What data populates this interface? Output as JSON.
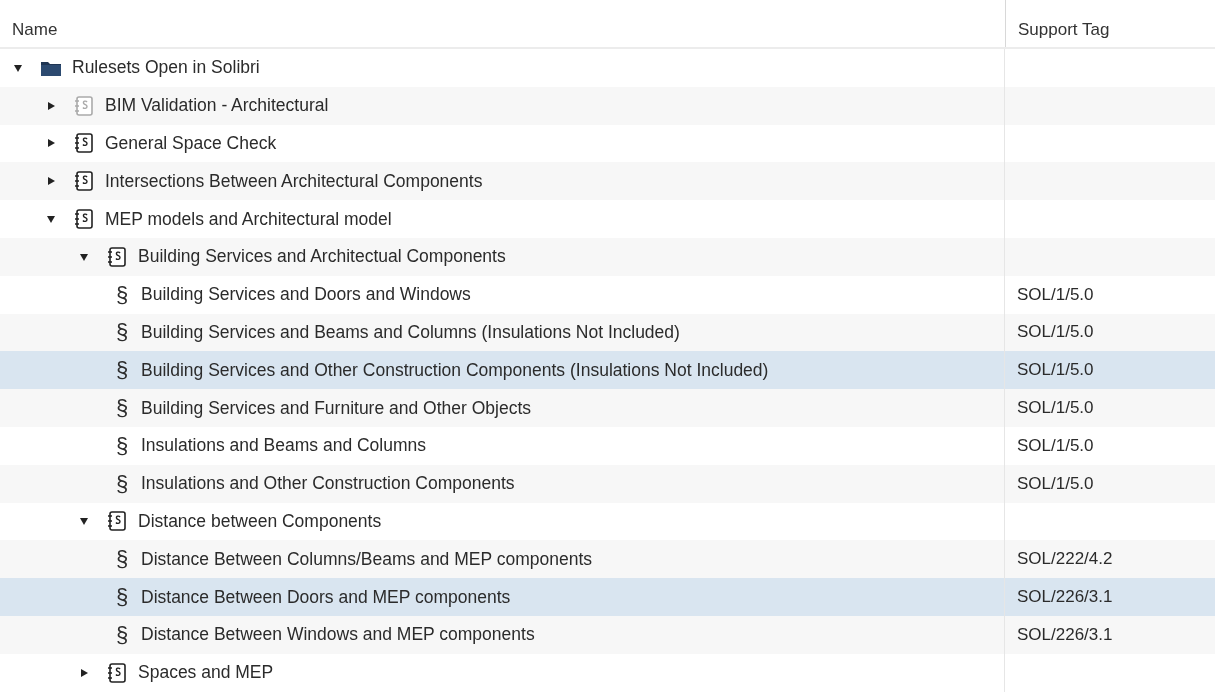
{
  "table": {
    "columns": [
      "Name",
      "Support Tag"
    ],
    "tree": [
      {
        "kind": "folder",
        "name": "Rulesets Open in Solibri",
        "expanded": true,
        "selected": false,
        "children": [
          {
            "kind": "ruleset-gray",
            "name": "BIM Validation - Architectural",
            "expanded": false,
            "selected": false
          },
          {
            "kind": "ruleset",
            "name": "General Space Check",
            "expanded": false,
            "selected": false
          },
          {
            "kind": "ruleset",
            "name": "Intersections Between Architectural Components",
            "expanded": false,
            "selected": false
          },
          {
            "kind": "ruleset",
            "name": "MEP models and Architectural model",
            "expanded": true,
            "selected": false,
            "children": [
              {
                "kind": "ruleset",
                "name": "Building Services and Architectual Components",
                "expanded": true,
                "selected": false,
                "children": [
                  {
                    "kind": "rule",
                    "glyph": "§",
                    "name": "Building Services and Doors and Windows",
                    "tag": "SOL/1/5.0",
                    "selected": false
                  },
                  {
                    "kind": "rule",
                    "glyph": "§",
                    "name": "Building Services and Beams and Columns (Insulations Not Included)",
                    "tag": "SOL/1/5.0",
                    "selected": false
                  },
                  {
                    "kind": "rule",
                    "glyph": "§",
                    "name": "Building Services and Other Construction Components (Insulations Not Included)",
                    "tag": "SOL/1/5.0",
                    "selected": true
                  },
                  {
                    "kind": "rule",
                    "glyph": "§",
                    "name": "Building Services and Furniture and Other Objects",
                    "tag": "SOL/1/5.0",
                    "selected": false
                  },
                  {
                    "kind": "rule",
                    "glyph": "§",
                    "name": "Insulations and Beams and Columns",
                    "tag": "SOL/1/5.0",
                    "selected": false
                  },
                  {
                    "kind": "rule",
                    "glyph": "§",
                    "name": "Insulations and Other Construction Components",
                    "tag": "SOL/1/5.0",
                    "selected": false
                  }
                ]
              },
              {
                "kind": "ruleset",
                "name": "Distance between Components",
                "expanded": true,
                "selected": false,
                "children": [
                  {
                    "kind": "rule",
                    "glyph": "§",
                    "name": "Distance Between Columns/Beams and MEP components",
                    "tag": "SOL/222/4.2",
                    "selected": false
                  },
                  {
                    "kind": "rule",
                    "glyph": "§",
                    "name": "Distance Between Doors  and MEP components",
                    "tag": "SOL/226/3.1",
                    "selected": true
                  },
                  {
                    "kind": "rule",
                    "glyph": "§",
                    "name": "Distance Between Windows  and MEP components",
                    "tag": "SOL/226/3.1",
                    "selected": false
                  }
                ]
              },
              {
                "kind": "ruleset",
                "name": "Spaces and MEP",
                "expanded": false,
                "selected": false
              }
            ]
          }
        ]
      }
    ]
  }
}
